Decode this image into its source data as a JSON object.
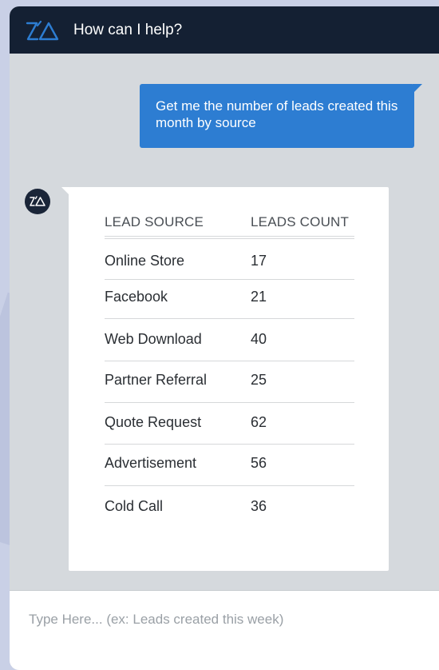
{
  "header": {
    "logo_icon": "zia-logo-icon",
    "title": "How can I help?"
  },
  "conversation": {
    "user_message": "Get me the number of leads created this month by source",
    "bot_avatar_icon": "zia-avatar-icon",
    "table": {
      "columns": [
        "LEAD SOURCE",
        "LEADS COUNT"
      ],
      "rows": [
        {
          "source": "Online Store",
          "count": "17"
        },
        {
          "source": "Facebook",
          "count": "21"
        },
        {
          "source": "Web Download",
          "count": "40"
        },
        {
          "source": "Partner Referral",
          "count": "25"
        },
        {
          "source": "Quote Request",
          "count": "62"
        },
        {
          "source": "Advertisement",
          "count": "56"
        },
        {
          "source": "Cold Call",
          "count": "36"
        }
      ]
    }
  },
  "input": {
    "placeholder": "Type Here... (ex: Leads created this week)",
    "value": ""
  },
  "colors": {
    "header_bg": "#142033",
    "user_bubble": "#2d7dd2",
    "chat_bg": "#d5d9dd",
    "logo_accent": "#2d7dd2"
  }
}
